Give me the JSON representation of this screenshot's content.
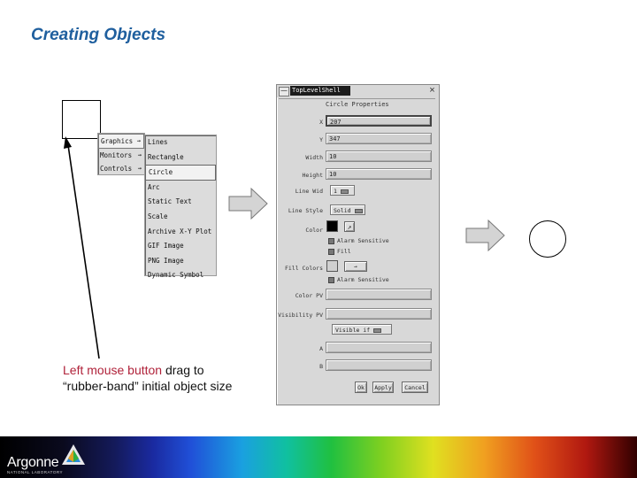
{
  "title": "Creating Objects",
  "caption": {
    "red": "Left mouse button",
    "rest1": " drag to",
    "line2": "“rubber-band” initial object size"
  },
  "main_menu": {
    "items": [
      {
        "label": "Graphics",
        "arrow": "→",
        "selected": true
      },
      {
        "label": "Monitors",
        "arrow": "→",
        "selected": false
      },
      {
        "label": "Controls",
        "arrow": "→",
        "selected": false
      }
    ]
  },
  "sub_menu": {
    "items": [
      {
        "label": "Lines",
        "selected": false
      },
      {
        "label": "Rectangle",
        "selected": false
      },
      {
        "label": "Circle",
        "selected": true
      },
      {
        "label": "Arc",
        "selected": false
      },
      {
        "label": "Static Text",
        "selected": false
      },
      {
        "label": "Scale",
        "selected": false
      },
      {
        "label": "Archive X-Y Plot",
        "selected": false
      },
      {
        "label": "GIF Image",
        "selected": false
      },
      {
        "label": "PNG Image",
        "selected": false
      },
      {
        "label": "Dynamic Symbol",
        "selected": false
      }
    ]
  },
  "dialog": {
    "title": "TopLevelShell",
    "header": "Circle Properties",
    "x_label": "X",
    "x_value": "207",
    "y_label": "Y",
    "y_value": "347",
    "width_label": "Width",
    "width_value": "10",
    "height_label": "Height",
    "height_value": "10",
    "line_width_label": "Line Wid",
    "line_width_value": "1",
    "line_style_label": "Line Style",
    "line_style_value": "Solid",
    "color_label": "Color",
    "color_value": "#000000",
    "alarm_sensitive_1": "Alarm Sensitive",
    "fill_label": "Fill",
    "fill_colors_label": "Fill Colors",
    "fill_color_value": "#d0d0d0",
    "alarm_sensitive_2": "Alarm Sensitive",
    "color_pv_label": "Color PV",
    "color_pv_value": "",
    "visibility_pv_label": "Visibility PV",
    "visibility_pv_value": "",
    "visibility_option": "Visible if",
    "field_a_label": "A",
    "field_b_label": "B",
    "ok_label": "Ok",
    "apply_label": "Apply",
    "cancel_label": "Cancel"
  },
  "footer": {
    "logo_text": "Argonne",
    "logo_sub": "NATIONAL LABORATORY"
  },
  "colors": {
    "title": "#1f5f9e",
    "caption_red": "#b0223a",
    "arrow_fill": "#d4d4d4"
  }
}
